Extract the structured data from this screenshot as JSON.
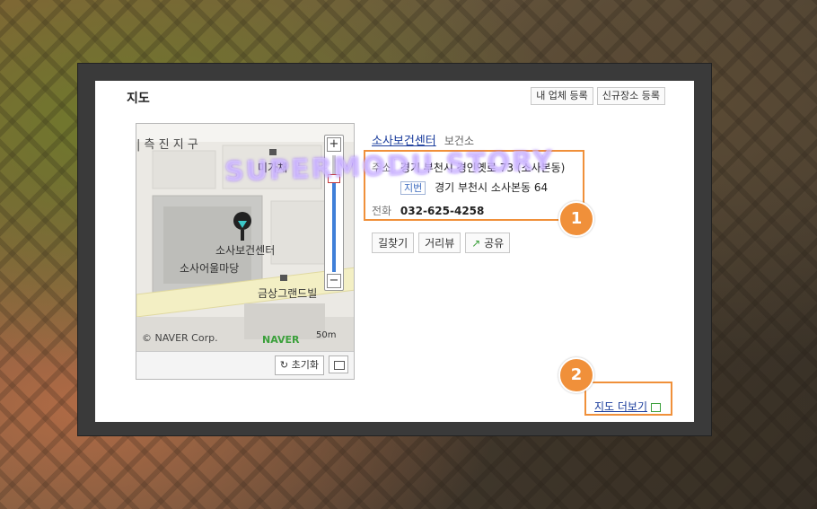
{
  "panel": {
    "title": "지도",
    "register_business": "내 업체 등록",
    "register_new_place": "신규장소 등록"
  },
  "map": {
    "labels": {
      "district": "| 측 진 지 구",
      "migachae": "미가채",
      "poi": "소사보건센터",
      "plaza": "소사어울마당",
      "villa": "금상그랜드빌"
    },
    "copyright": "© NAVER Corp.",
    "brand": "NAVER",
    "scale": "50m",
    "reset_label": "초기화",
    "zoom_in": "+",
    "zoom_out": "−",
    "zoom_level_fraction": 0.8,
    "pin_icon": "map-pin-icon"
  },
  "place": {
    "name": "소사보건센터",
    "category": "보건소",
    "address_label": "주소",
    "address": "경기 부천시 경인옛로 73 (소사본동)",
    "jibun_label": "지번",
    "jibun": "경기 부천시 소사본동 64",
    "phone_label": "전화",
    "phone": "032-625-4258"
  },
  "actions": {
    "directions": "길찾기",
    "street_view": "거리뷰",
    "share": "공유"
  },
  "more_map": "지도 더보기",
  "badges": [
    "1",
    "2"
  ],
  "watermark": "SUPERMODU STORY",
  "colors": {
    "highlight": "#f0903a",
    "link": "#1a3c9c",
    "naver_green": "#3ba03b"
  }
}
